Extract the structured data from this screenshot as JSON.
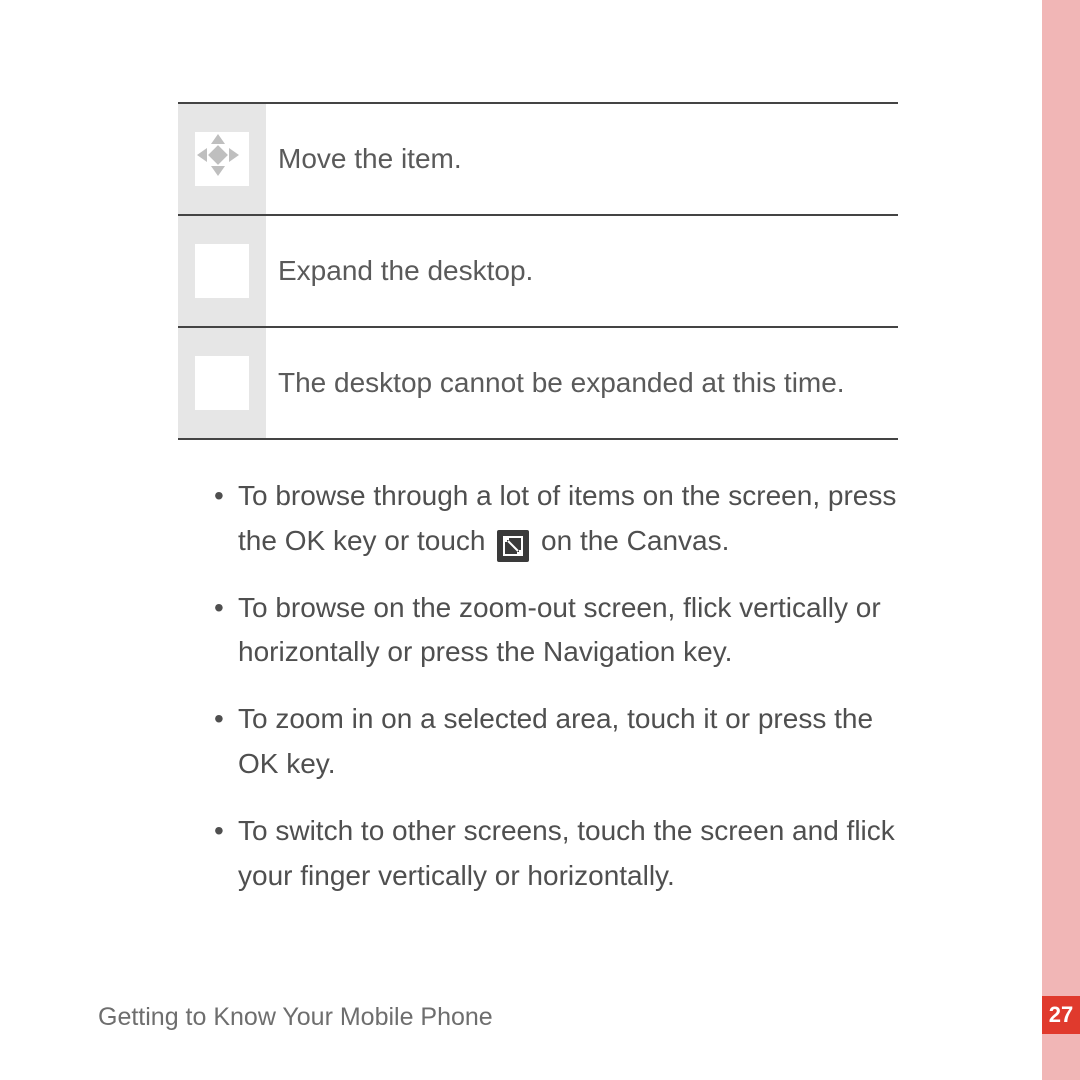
{
  "table": {
    "rows": [
      {
        "text": "Move the item."
      },
      {
        "text": "Expand the desktop."
      },
      {
        "text": "The desktop cannot be expanded at this time."
      }
    ]
  },
  "bullets": [
    {
      "pre": "To browse through a lot of items on the screen, press the OK key or touch ",
      "post": " on the Canvas.",
      "has_icon": true
    },
    {
      "text": "To browse on the zoom-out screen, flick vertically or horizontally or press the Navigation key."
    },
    {
      "text": "To zoom in on a selected area, touch it or press the OK key."
    },
    {
      "text": "To switch to other screens, touch the screen and flick your finger vertically or horizontally."
    }
  ],
  "footer": "Getting to Know Your Mobile Phone",
  "page_number": "27"
}
